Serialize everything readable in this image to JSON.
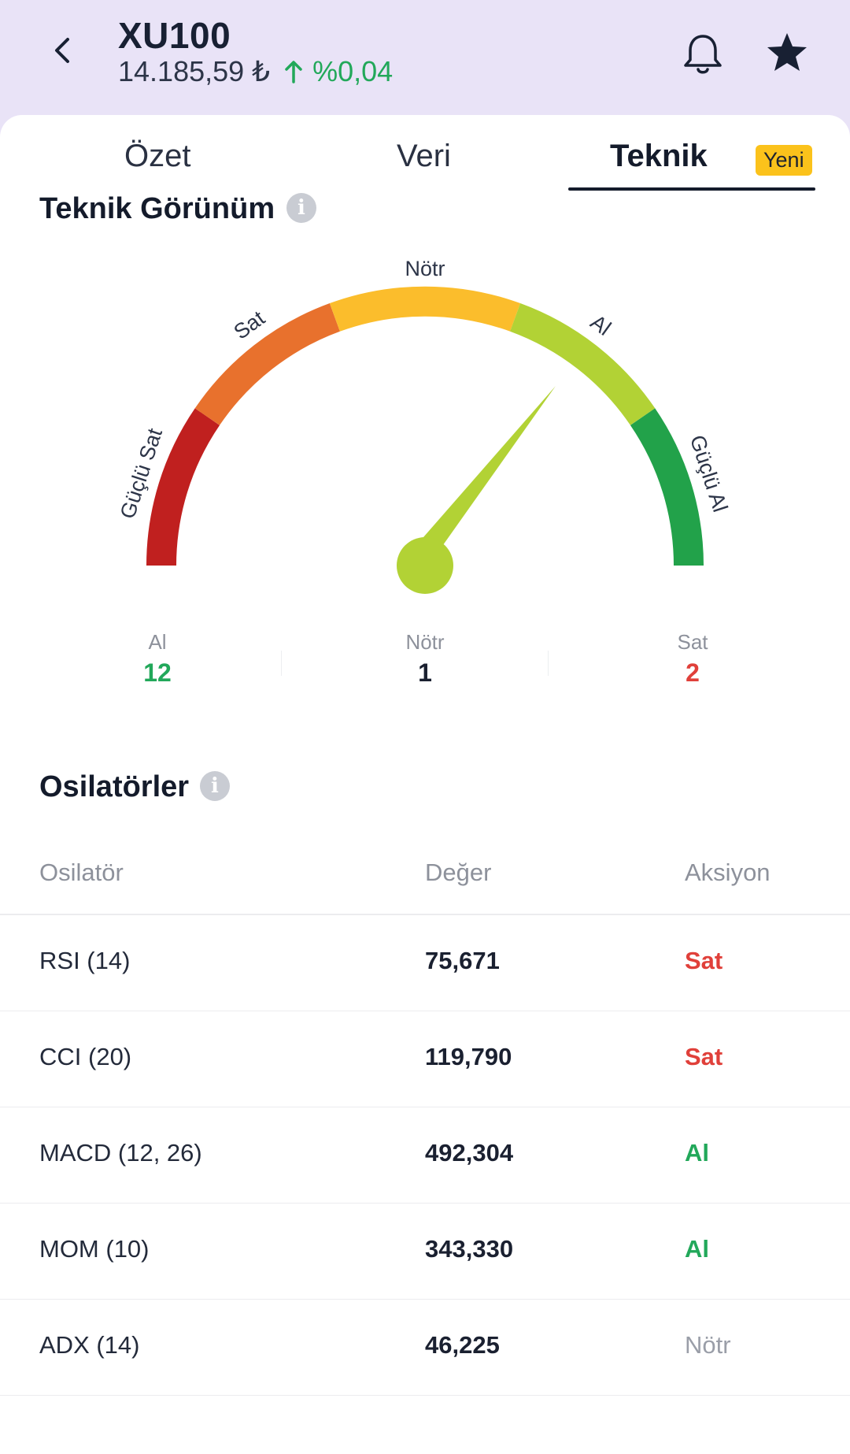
{
  "header": {
    "ticker": "XU100",
    "price": "14.185,59 ₺",
    "change": "%0,04"
  },
  "tabs": [
    {
      "label": "Özet"
    },
    {
      "label": "Veri"
    },
    {
      "label": "Teknik",
      "active": true,
      "badge": "Yeni"
    }
  ],
  "technical": {
    "title": "Teknik Görünüm",
    "gauge_labels": {
      "strong_sell": "Güçlü Sat",
      "sell": "Sat",
      "neutral": "Nötr",
      "buy": "Al",
      "strong_buy": "Güçlü Al"
    },
    "gauge_colors": [
      "#c0201f",
      "#e8712d",
      "#fbbd2c",
      "#b2d235",
      "#22a24a"
    ],
    "needle_color": "#b2d235",
    "summary": [
      {
        "label": "Al",
        "count": "12",
        "color": "#22a85a"
      },
      {
        "label": "Nötr",
        "count": "1",
        "color": "#1a2030"
      },
      {
        "label": "Sat",
        "count": "2",
        "color": "#e0403a"
      }
    ]
  },
  "oscillators": {
    "title": "Osilatörler",
    "headers": [
      "Osilatör",
      "Değer",
      "Aksiyon"
    ],
    "rows": [
      {
        "name": "RSI (14)",
        "value": "75,671",
        "action": "Sat",
        "color": "#e0403a"
      },
      {
        "name": "CCI (20)",
        "value": "119,790",
        "action": "Sat",
        "color": "#e0403a"
      },
      {
        "name": "MACD (12, 26)",
        "value": "492,304",
        "action": "Al",
        "color": "#22a85a"
      },
      {
        "name": "MOM (10)",
        "value": "343,330",
        "action": "Al",
        "color": "#22a85a"
      },
      {
        "name": "ADX (14)",
        "value": "46,225",
        "action": "Nötr",
        "color": "#9a9ea8"
      }
    ]
  }
}
